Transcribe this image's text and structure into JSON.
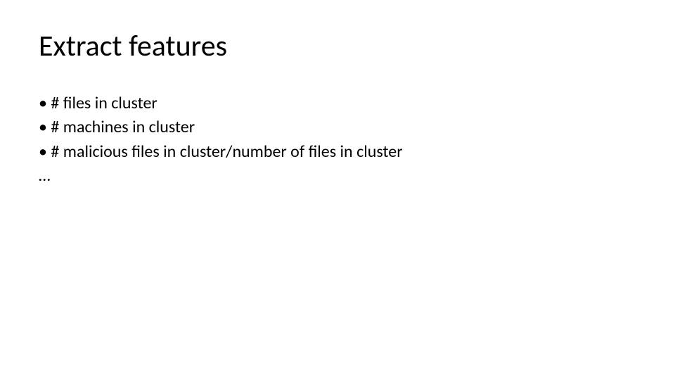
{
  "slide": {
    "title": "Extract features",
    "bullets": [
      "# files in cluster",
      "# machines in cluster",
      "# malicious files in cluster/number of files in cluster"
    ],
    "trailing": "…"
  }
}
